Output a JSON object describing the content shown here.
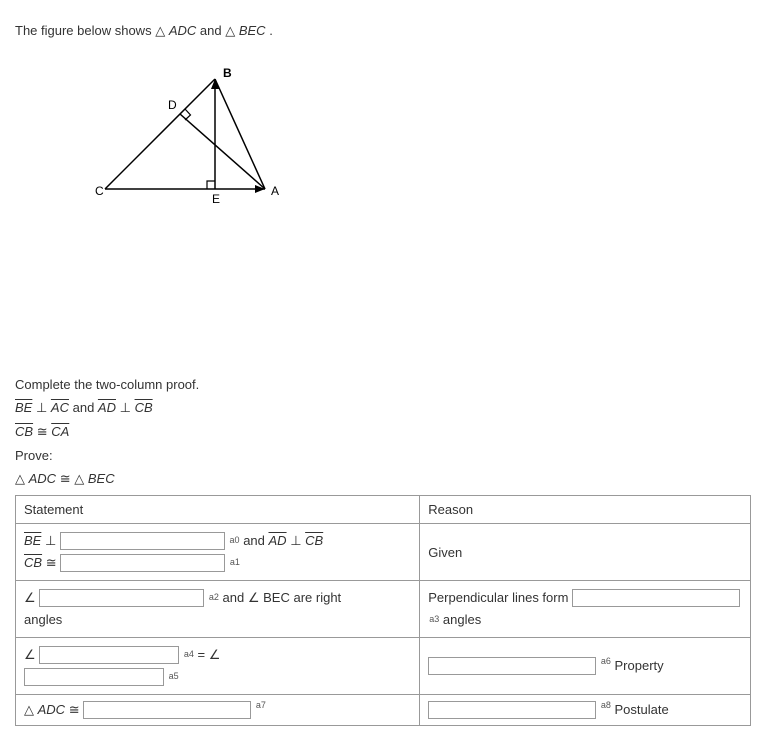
{
  "intro": {
    "prefix": "The figure below shows ",
    "t1": " ADC",
    "mid": " and ",
    "t2": " BEC",
    "suffix": "."
  },
  "figureLabels": {
    "A": "A",
    "B": "B",
    "C": "C",
    "D": "D",
    "E": "E"
  },
  "sections": {
    "complete": "Complete the two-column proof.",
    "given1_a": "BE",
    "given1_b": "AC",
    "given1_mid": " and ",
    "given1_c": "AD",
    "given1_d": "CB",
    "given2_a": "CB",
    "given2_b": "CA",
    "proveLabel": "Prove:",
    "prove_t1": " ADC",
    "prove_t2": " BEC"
  },
  "tableHeaders": {
    "statement": "Statement",
    "reason": "Reason"
  },
  "row1": {
    "stmt_a": "BE",
    "stmt_mid": " and ",
    "stmt_b": "AD",
    "stmt_c": "CB",
    "stmt2_a": "CB",
    "reason": "Given",
    "sup0": "a0",
    "sup1": "a1"
  },
  "row2": {
    "stmt_mid": " and ",
    "stmt_b": "BEC are right",
    "stmt_c": "angles",
    "reason_a": "Perpendicular lines form ",
    "reason_b": " angles",
    "sup2": "a2",
    "sup3": "a3"
  },
  "row3": {
    "eq": " = ",
    "reason_suffix": " Property",
    "sup4": "a4",
    "sup5": "a5",
    "sup6": "a6"
  },
  "row4": {
    "stmt_a": " ADC",
    "reason_suffix": " Postulate",
    "sup7": "a7",
    "sup8": "a8"
  },
  "symbols": {
    "triangle": "△",
    "perp": "⊥",
    "cong": "≅",
    "angle": "∠"
  }
}
